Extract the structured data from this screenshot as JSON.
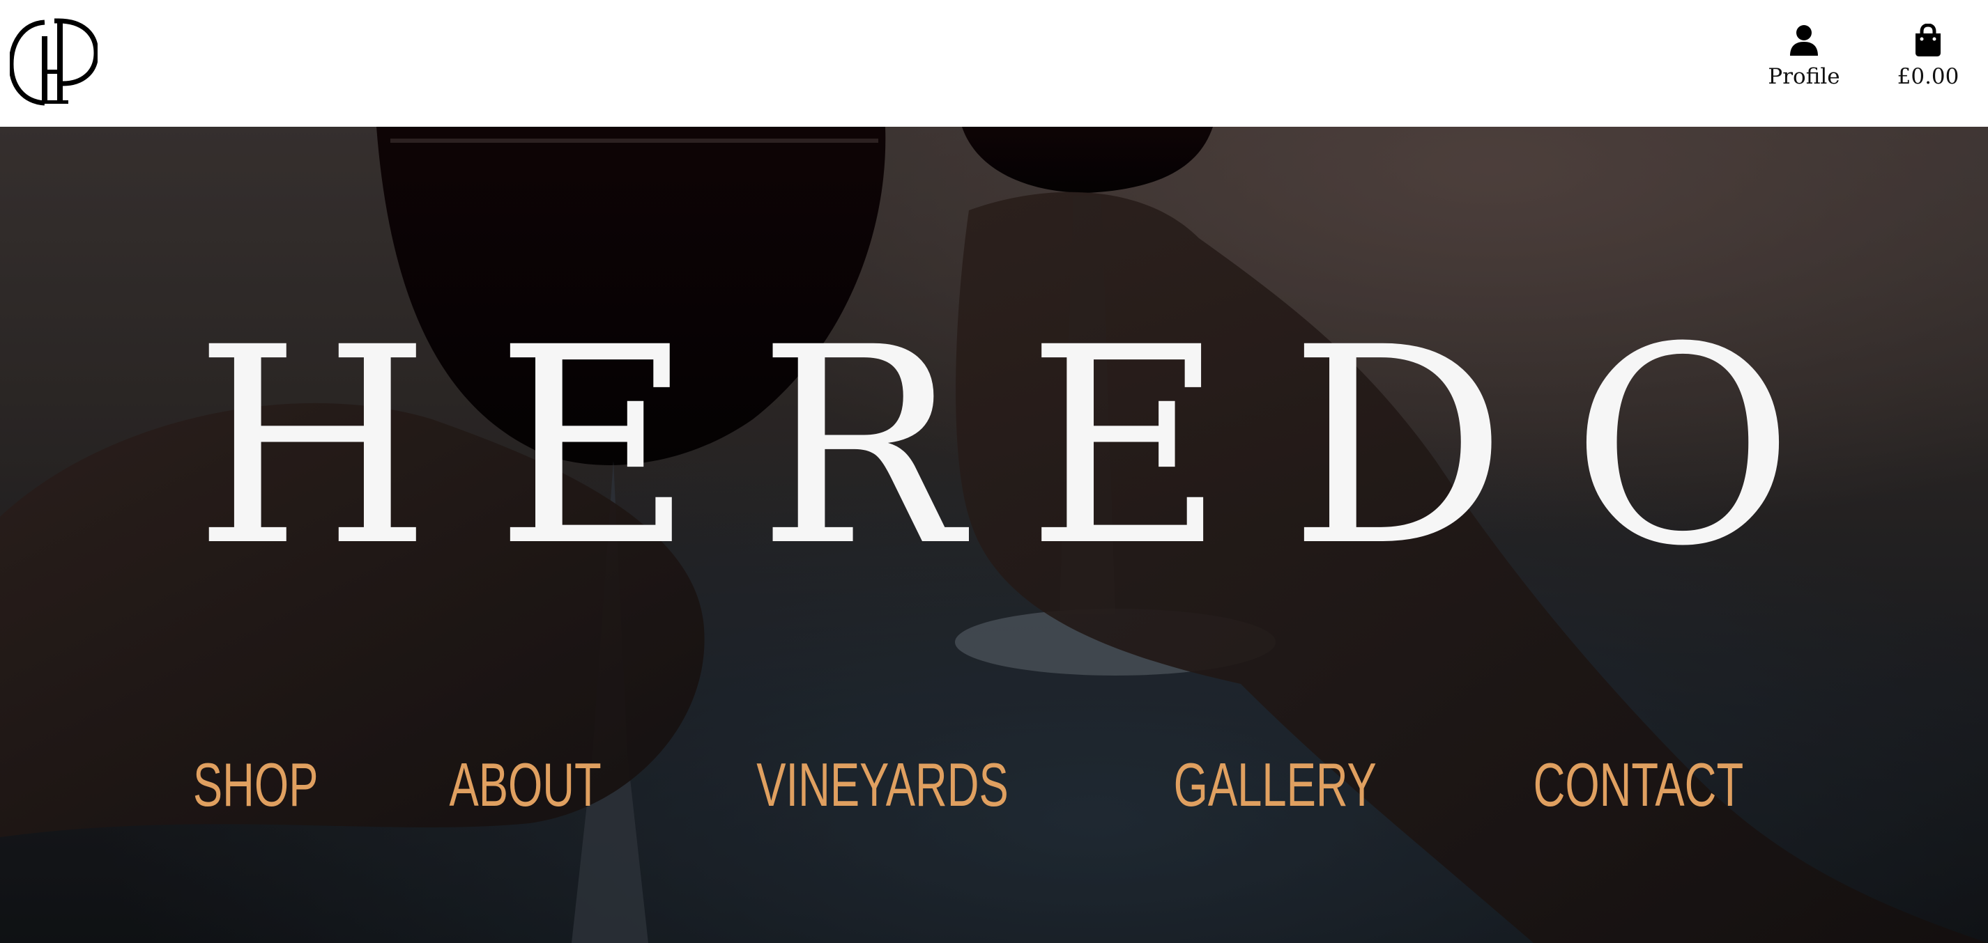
{
  "header": {
    "logo_alt": "HP",
    "profile_label": "Profile",
    "cart_total": "£0.00"
  },
  "hero": {
    "title": "HEREDO"
  },
  "nav": {
    "items": [
      {
        "label": "SHOP"
      },
      {
        "label": "ABOUT"
      },
      {
        "label": "VINEYARDS"
      },
      {
        "label": "GALLERY"
      },
      {
        "label": "CONTACT"
      }
    ]
  },
  "colors": {
    "header_bg": "#ffffff",
    "title": "#f6f6f6",
    "nav_link": "#e0a060",
    "hero_overlay": "#2a2624"
  },
  "icons": [
    "hp-monogram-logo",
    "user-icon",
    "shopping-bag-icon"
  ]
}
